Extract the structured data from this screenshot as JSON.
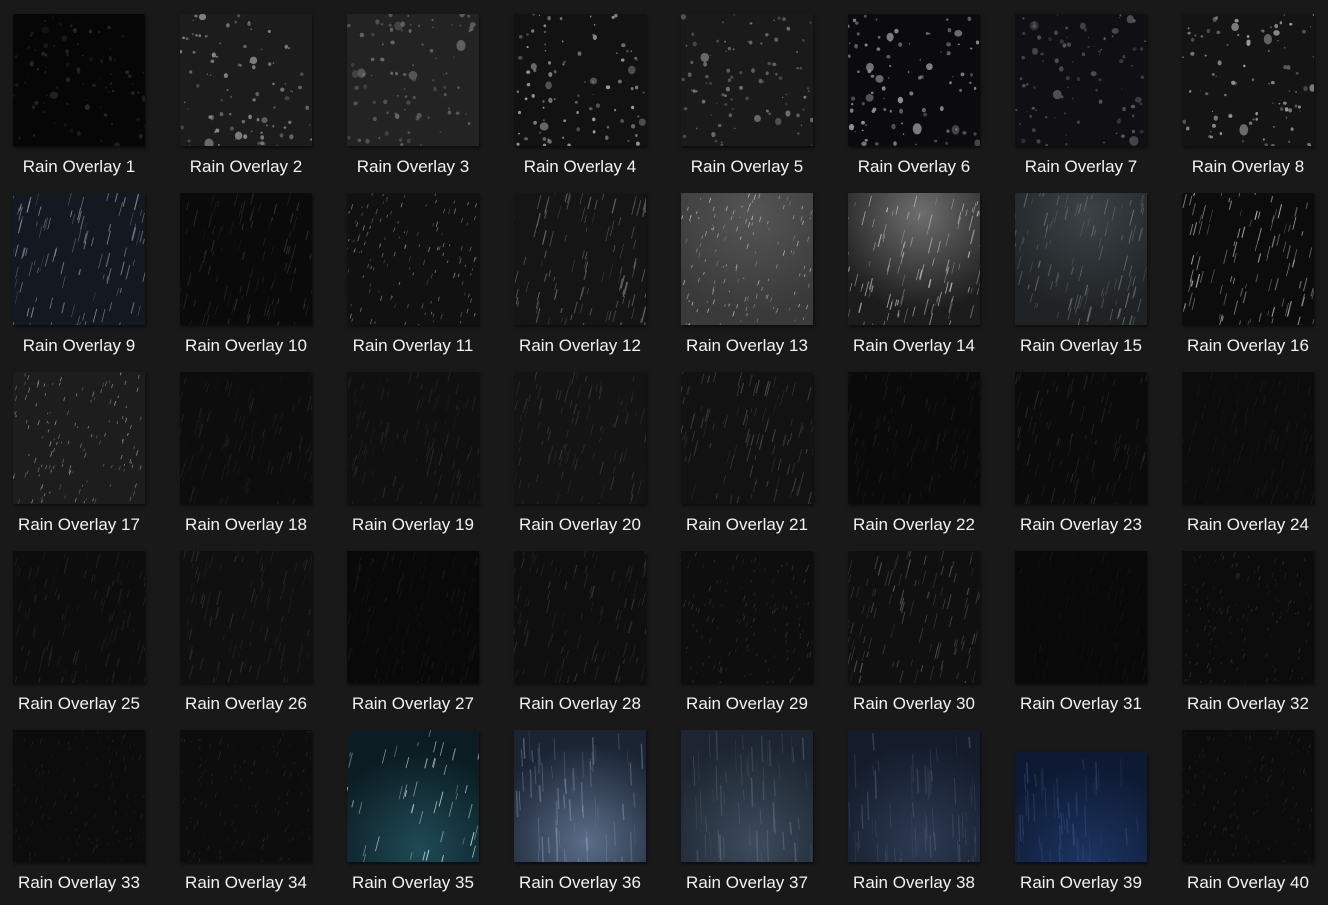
{
  "items": [
    {
      "label": "Rain Overlay 1",
      "style": "drops",
      "bg": "#060606",
      "fg": "#2a2a2a",
      "tint": "#000000"
    },
    {
      "label": "Rain Overlay 2",
      "style": "drops",
      "bg": "#1c1c1c",
      "fg": "#8a8a8a",
      "tint": "#000000"
    },
    {
      "label": "Rain Overlay 3",
      "style": "drops",
      "bg": "#232323",
      "fg": "#6a6a6a",
      "tint": "#000000"
    },
    {
      "label": "Rain Overlay 4",
      "style": "drops",
      "bg": "#121212",
      "fg": "#a5a5a5",
      "tint": "#000000"
    },
    {
      "label": "Rain Overlay 5",
      "style": "drops",
      "bg": "#1a1a1a",
      "fg": "#7a7a7a",
      "tint": "#000000"
    },
    {
      "label": "Rain Overlay 6",
      "style": "drops",
      "bg": "#0b0b0d",
      "fg": "#9a9a9a",
      "tint": "#000000"
    },
    {
      "label": "Rain Overlay 7",
      "style": "drops",
      "bg": "#101014",
      "fg": "#5a5a5e",
      "tint": "#000000"
    },
    {
      "label": "Rain Overlay 8",
      "style": "drops",
      "bg": "#141414",
      "fg": "#a0a0a0",
      "tint": "#000000"
    },
    {
      "label": "Rain Overlay 9",
      "style": "streak",
      "bg": "#141820",
      "fg": "#8e98a8",
      "tint": "#000000"
    },
    {
      "label": "Rain Overlay 10",
      "style": "streak",
      "bg": "#0a0a0a",
      "fg": "#333333",
      "tint": "#000000"
    },
    {
      "label": "Rain Overlay 11",
      "style": "dash",
      "bg": "#111111",
      "fg": "#8a8a8a",
      "tint": "#000000"
    },
    {
      "label": "Rain Overlay 12",
      "style": "streak",
      "bg": "#151515",
      "fg": "#6e6e6e",
      "tint": "#000000"
    },
    {
      "label": "Rain Overlay 13",
      "style": "dash",
      "bg": "#3a3a3a",
      "fg": "#bdbdbd",
      "tint": "#555555"
    },
    {
      "label": "Rain Overlay 14",
      "style": "streak",
      "bg": "#1c1c1c",
      "fg": "#c8c8c8",
      "tint": "#6e6e6e"
    },
    {
      "label": "Rain Overlay 15",
      "style": "streak",
      "bg": "#1f2326",
      "fg": "#6b7478",
      "tint": "#3c4246"
    },
    {
      "label": "Rain Overlay 16",
      "style": "streak",
      "bg": "#0c0c0c",
      "fg": "#b0b0b0",
      "tint": "#000000"
    },
    {
      "label": "Rain Overlay 17",
      "style": "dash",
      "bg": "#1d1d1d",
      "fg": "#9a9a9a",
      "tint": "#000000"
    },
    {
      "label": "Rain Overlay 18",
      "style": "streak",
      "bg": "#0d0d0d",
      "fg": "#262626",
      "tint": "#000000"
    },
    {
      "label": "Rain Overlay 19",
      "style": "streak",
      "bg": "#101010",
      "fg": "#2c2c2c",
      "tint": "#000000"
    },
    {
      "label": "Rain Overlay 20",
      "style": "streak",
      "bg": "#141414",
      "fg": "#3a3a3a",
      "tint": "#000000"
    },
    {
      "label": "Rain Overlay 21",
      "style": "streak",
      "bg": "#121212",
      "fg": "#4a4a4a",
      "tint": "#000000"
    },
    {
      "label": "Rain Overlay 22",
      "style": "streak",
      "bg": "#0a0a0a",
      "fg": "#1f1f1f",
      "tint": "#000000"
    },
    {
      "label": "Rain Overlay 23",
      "style": "streak",
      "bg": "#0b0b0b",
      "fg": "#2b2b2b",
      "tint": "#000000"
    },
    {
      "label": "Rain Overlay 24",
      "style": "streak",
      "bg": "#0c0c0c",
      "fg": "#1c1c1c",
      "tint": "#000000"
    },
    {
      "label": "Rain Overlay 25",
      "style": "streak",
      "bg": "#0d0d0d",
      "fg": "#2a2a2a",
      "tint": "#000000"
    },
    {
      "label": "Rain Overlay 26",
      "style": "streak",
      "bg": "#101010",
      "fg": "#303030",
      "tint": "#000000"
    },
    {
      "label": "Rain Overlay 27",
      "style": "streak",
      "bg": "#090909",
      "fg": "#1d1d1d",
      "tint": "#000000"
    },
    {
      "label": "Rain Overlay 28",
      "style": "streak",
      "bg": "#0f0f0f",
      "fg": "#383838",
      "tint": "#000000"
    },
    {
      "label": "Rain Overlay 29",
      "style": "dash",
      "bg": "#0e0e0e",
      "fg": "#3c3c3c",
      "tint": "#000000"
    },
    {
      "label": "Rain Overlay 30",
      "style": "streak",
      "bg": "#101010",
      "fg": "#585858",
      "tint": "#000000"
    },
    {
      "label": "Rain Overlay 31",
      "style": "streak",
      "bg": "#090909",
      "fg": "#161616",
      "tint": "#000000"
    },
    {
      "label": "Rain Overlay 32",
      "style": "dash",
      "bg": "#0c0c0c",
      "fg": "#363636",
      "tint": "#000000"
    },
    {
      "label": "Rain Overlay 33",
      "style": "dash",
      "bg": "#0c0c0c",
      "fg": "#262626",
      "tint": "#000000"
    },
    {
      "label": "Rain Overlay 34",
      "style": "dash",
      "bg": "#0d0d0d",
      "fg": "#2a2a2a",
      "tint": "#000000"
    },
    {
      "label": "Rain Overlay 35",
      "style": "teal",
      "bg": "#0b1c22",
      "fg": "#cfe0e6",
      "tint": "#1f4a56"
    },
    {
      "label": "Rain Overlay 36",
      "style": "blue",
      "bg": "#1a2433",
      "fg": "#8ea0bb",
      "tint": "#5b6d88"
    },
    {
      "label": "Rain Overlay 37",
      "style": "blue",
      "bg": "#1c2530",
      "fg": "#6d7c8e",
      "tint": "#3d4b5c"
    },
    {
      "label": "Rain Overlay 38",
      "style": "blue",
      "bg": "#141c2b",
      "fg": "#5c6b85",
      "tint": "#2d3a52"
    },
    {
      "label": "Rain Overlay 39",
      "style": "navy",
      "bg": "#0e1a33",
      "fg": "#3e5a88",
      "tint": "#1d3563"
    },
    {
      "label": "Rain Overlay 40",
      "style": "dash",
      "bg": "#0c0c0c",
      "fg": "#2c2c2c",
      "tint": "#000000"
    }
  ]
}
